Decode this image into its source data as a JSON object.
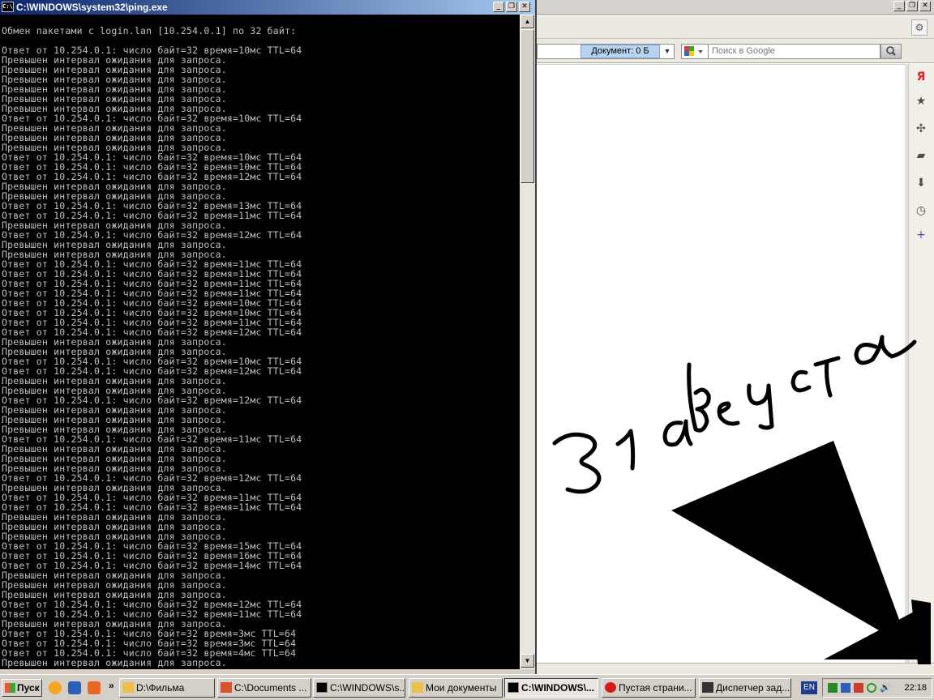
{
  "console": {
    "title": "C:\\WINDOWS\\system32\\ping.exe",
    "icon_label": "C:\\",
    "lines": [
      "Обмен пакетами с login.lan [10.254.0.1] по 32 байт:",
      "",
      "Ответ от 10.254.0.1: число байт=32 время=10мс TTL=64",
      "Превышен интервал ожидания для запроса.",
      "Превышен интервал ожидания для запроса.",
      "Превышен интервал ожидания для запроса.",
      "Превышен интервал ожидания для запроса.",
      "Превышен интервал ожидания для запроса.",
      "Превышен интервал ожидания для запроса.",
      "Ответ от 10.254.0.1: число байт=32 время=10мс TTL=64",
      "Превышен интервал ожидания для запроса.",
      "Превышен интервал ожидания для запроса.",
      "Превышен интервал ожидания для запроса.",
      "Ответ от 10.254.0.1: число байт=32 время=10мс TTL=64",
      "Ответ от 10.254.0.1: число байт=32 время=10мс TTL=64",
      "Ответ от 10.254.0.1: число байт=32 время=12мс TTL=64",
      "Превышен интервал ожидания для запроса.",
      "Превышен интервал ожидания для запроса.",
      "Ответ от 10.254.0.1: число байт=32 время=13мс TTL=64",
      "Ответ от 10.254.0.1: число байт=32 время=11мс TTL=64",
      "Превышен интервал ожидания для запроса.",
      "Ответ от 10.254.0.1: число байт=32 время=12мс TTL=64",
      "Превышен интервал ожидания для запроса.",
      "Превышен интервал ожидания для запроса.",
      "Ответ от 10.254.0.1: число байт=32 время=11мс TTL=64",
      "Ответ от 10.254.0.1: число байт=32 время=11мс TTL=64",
      "Ответ от 10.254.0.1: число байт=32 время=11мс TTL=64",
      "Ответ от 10.254.0.1: число байт=32 время=11мс TTL=64",
      "Ответ от 10.254.0.1: число байт=32 время=10мс TTL=64",
      "Ответ от 10.254.0.1: число байт=32 время=10мс TTL=64",
      "Ответ от 10.254.0.1: число байт=32 время=11мс TTL=64",
      "Ответ от 10.254.0.1: число байт=32 время=12мс TTL=64",
      "Превышен интервал ожидания для запроса.",
      "Превышен интервал ожидания для запроса.",
      "Ответ от 10.254.0.1: число байт=32 время=10мс TTL=64",
      "Ответ от 10.254.0.1: число байт=32 время=12мс TTL=64",
      "Превышен интервал ожидания для запроса.",
      "Превышен интервал ожидания для запроса.",
      "Ответ от 10.254.0.1: число байт=32 время=12мс TTL=64",
      "Превышен интервал ожидания для запроса.",
      "Превышен интервал ожидания для запроса.",
      "Превышен интервал ожидания для запроса.",
      "Ответ от 10.254.0.1: число байт=32 время=11мс TTL=64",
      "Превышен интервал ожидания для запроса.",
      "Превышен интервал ожидания для запроса.",
      "Превышен интервал ожидания для запроса.",
      "Ответ от 10.254.0.1: число байт=32 время=12мс TTL=64",
      "Превышен интервал ожидания для запроса.",
      "Ответ от 10.254.0.1: число байт=32 время=11мс TTL=64",
      "Ответ от 10.254.0.1: число байт=32 время=11мс TTL=64",
      "Превышен интервал ожидания для запроса.",
      "Превышен интервал ожидания для запроса.",
      "Превышен интервал ожидания для запроса.",
      "Ответ от 10.254.0.1: число байт=32 время=15мс TTL=64",
      "Ответ от 10.254.0.1: число байт=32 время=16мс TTL=64",
      "Ответ от 10.254.0.1: число байт=32 время=14мс TTL=64",
      "Превышен интервал ожидания для запроса.",
      "Превышен интервал ожидания для запроса.",
      "Превышен интервал ожидания для запроса.",
      "Ответ от 10.254.0.1: число байт=32 время=12мс TTL=64",
      "Ответ от 10.254.0.1: число байт=32 время=11мс TTL=64",
      "Превышен интервал ожидания для запроса.",
      "Ответ от 10.254.0.1: число байт=32 время=3мс TTL=64",
      "Ответ от 10.254.0.1: число байт=32 время=3мс TTL=64",
      "Ответ от 10.254.0.1: число байт=32 время=4мс TTL=64",
      "Превышен интервал ожидания для запроса."
    ]
  },
  "browser": {
    "doc_size_label": "Документ: 0 Б",
    "search_placeholder": "Поиск в Google",
    "sidebar_icons": [
      "yandex-icon",
      "bookmarks-icon",
      "unite-icon",
      "notes-icon",
      "downloads-icon",
      "history-icon",
      "add-panel-icon"
    ],
    "handwriting": "31 августа"
  },
  "taskbar": {
    "start_label": "Пуск",
    "tasks": [
      {
        "label": "D:\\Фильма",
        "icon": "folder-icon"
      },
      {
        "label": "C:\\Documents ...",
        "icon": "documents-icon"
      },
      {
        "label": "C:\\WINDOWS\\s...",
        "icon": "console-icon"
      },
      {
        "label": "Мои документы",
        "icon": "folder-icon"
      },
      {
        "label": "C:\\WINDOWS\\...",
        "icon": "console-icon",
        "active": true
      },
      {
        "label": "Пустая страни...",
        "icon": "opera-icon"
      },
      {
        "label": "Диспетчер зад...",
        "icon": "task-manager-icon"
      }
    ],
    "language": "EN",
    "clock": "22:18"
  },
  "colors": {
    "console_bg": "#000000",
    "console_text": "#c0c0c0",
    "titlebar_start": "#0a246a",
    "titlebar_end": "#a6caf0"
  }
}
